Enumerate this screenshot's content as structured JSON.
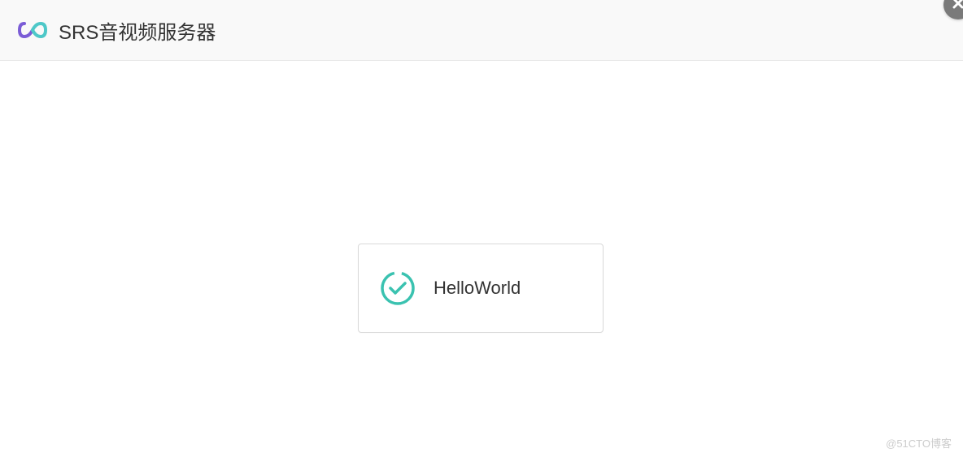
{
  "header": {
    "title": "SRS音视频服务器"
  },
  "modal": {
    "message": "HelloWorld",
    "icon": "success-check-icon"
  },
  "watermark": "@51CTO博客",
  "colors": {
    "accent": "#3ac2b0",
    "logo_purple": "#7b5dd6",
    "logo_teal": "#4ec8c8"
  }
}
